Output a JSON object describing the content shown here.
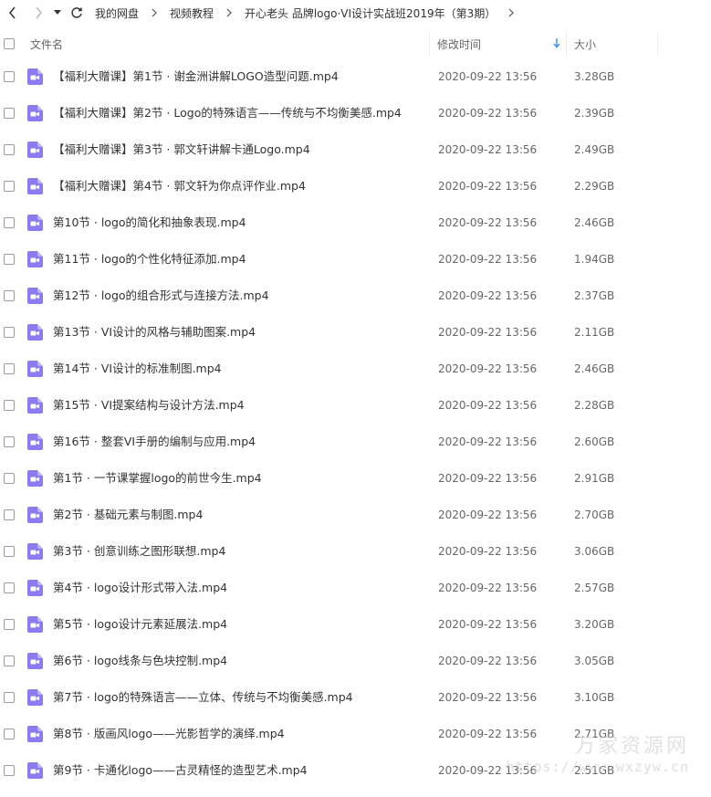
{
  "breadcrumb": [
    "我的网盘",
    "视频教程",
    "开心老头 品牌logo·VI设计实战班2019年（第3期）"
  ],
  "header": {
    "name": "文件名",
    "time": "修改时间",
    "size": "大小"
  },
  "files": [
    {
      "name": "【福利大赠课】第1节 · 谢金洲讲解LOGO造型问题.mp4",
      "time": "2020-09-22 13:56",
      "size": "3.28GB"
    },
    {
      "name": "【福利大赠课】第2节 · Logo的特殊语言——传统与不均衡美感.mp4",
      "time": "2020-09-22 13:56",
      "size": "2.39GB"
    },
    {
      "name": "【福利大赠课】第3节 · 郭文轩讲解卡通Logo.mp4",
      "time": "2020-09-22 13:56",
      "size": "2.49GB"
    },
    {
      "name": "【福利大赠课】第4节 · 郭文轩为你点评作业.mp4",
      "time": "2020-09-22 13:56",
      "size": "2.29GB"
    },
    {
      "name": "第10节 · logo的简化和抽象表现.mp4",
      "time": "2020-09-22 13:56",
      "size": "2.46GB"
    },
    {
      "name": "第11节 · logo的个性化特征添加.mp4",
      "time": "2020-09-22 13:56",
      "size": "1.94GB"
    },
    {
      "name": "第12节 · logo的组合形式与连接方法.mp4",
      "time": "2020-09-22 13:56",
      "size": "2.37GB"
    },
    {
      "name": "第13节 · VI设计的风格与辅助图案.mp4",
      "time": "2020-09-22 13:56",
      "size": "2.11GB"
    },
    {
      "name": "第14节 · VI设计的标准制图.mp4",
      "time": "2020-09-22 13:56",
      "size": "2.46GB"
    },
    {
      "name": "第15节 · VI提案结构与设计方法.mp4",
      "time": "2020-09-22 13:56",
      "size": "2.28GB"
    },
    {
      "name": "第16节 · 整套VI手册的编制与应用.mp4",
      "time": "2020-09-22 13:56",
      "size": "2.60GB"
    },
    {
      "name": "第1节 · 一节课掌握logo的前世今生.mp4",
      "time": "2020-09-22 13:56",
      "size": "2.91GB"
    },
    {
      "name": "第2节 · 基础元素与制图.mp4",
      "time": "2020-09-22 13:56",
      "size": "2.70GB"
    },
    {
      "name": "第3节 · 创意训练之图形联想.mp4",
      "time": "2020-09-22 13:56",
      "size": "3.06GB"
    },
    {
      "name": "第4节 · logo设计形式带入法.mp4",
      "time": "2020-09-22 13:56",
      "size": "2.57GB"
    },
    {
      "name": "第5节 · logo设计元素延展法.mp4",
      "time": "2020-09-22 13:56",
      "size": "3.20GB"
    },
    {
      "name": "第6节 · logo线条与色块控制.mp4",
      "time": "2020-09-22 13:56",
      "size": "3.05GB"
    },
    {
      "name": "第7节 · logo的特殊语言——立体、传统与不均衡美感.mp4",
      "time": "2020-09-22 13:56",
      "size": "3.10GB"
    },
    {
      "name": "第8节 · 版画风logo——光影哲学的演绎.mp4",
      "time": "2020-09-22 13:56",
      "size": "2.71GB"
    },
    {
      "name": "第9节 · 卡通化logo——古灵精怪的造型艺术.mp4",
      "time": "2020-09-22 13:56",
      "size": "2.51GB"
    }
  ],
  "watermark": {
    "text": "万家资源网",
    "url": "https://www.wxzyw.cn"
  },
  "colors": {
    "video_icon": "#8a7cf0",
    "sort_arrow": "#3b8fe8"
  }
}
